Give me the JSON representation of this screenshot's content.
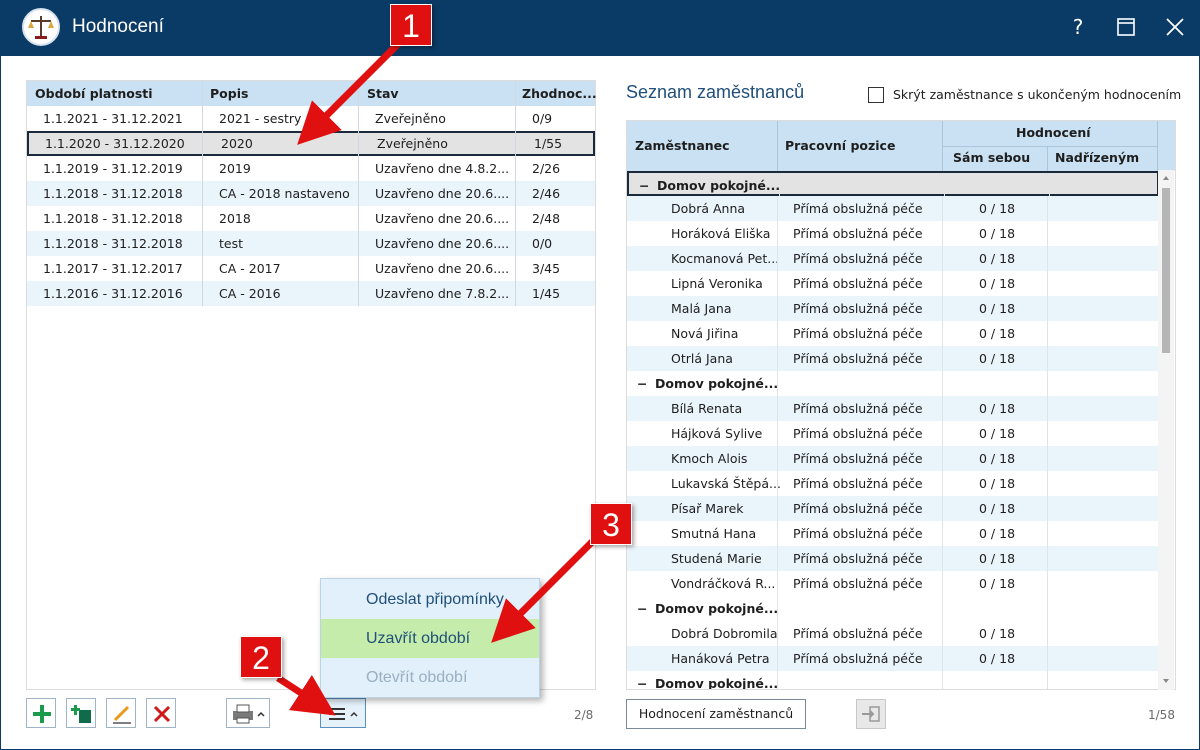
{
  "window": {
    "title": "Hodnocení",
    "help_label": "?",
    "icons": {
      "logo": "scales-icon",
      "help": "help-icon",
      "maximize": "maximize-icon",
      "close": "close-icon"
    }
  },
  "periods": {
    "columns": [
      "Období platnosti",
      "Popis",
      "Stav",
      "Zhodnoc..."
    ],
    "rows": [
      {
        "period": "1.1.2021 - 31.12.2021",
        "desc": "2021 - sestry",
        "state": "Zveřejněno",
        "score": "0/9"
      },
      {
        "period": "1.1.2020 - 31.12.2020",
        "desc": "2020",
        "state": "Zveřejněno",
        "score": "1/55"
      },
      {
        "period": "1.1.2019 - 31.12.2019",
        "desc": "2019",
        "state": "Uzavřeno dne 4.8.2...",
        "score": "2/26"
      },
      {
        "period": "1.1.2018 - 31.12.2018",
        "desc": "CA - 2018 nastaveno",
        "state": "Uzavřeno dne 20.6....",
        "score": "2/46"
      },
      {
        "period": "1.1.2018 - 31.12.2018",
        "desc": "2018",
        "state": "Uzavřeno dne 20.6....",
        "score": "2/48"
      },
      {
        "period": "1.1.2018 - 31.12.2018",
        "desc": "test",
        "state": "Uzavřeno dne 20.6....",
        "score": "0/0"
      },
      {
        "period": "1.1.2017 - 31.12.2017",
        "desc": "CA - 2017",
        "state": "Uzavřeno dne 20.6....",
        "score": "3/45"
      },
      {
        "period": "1.1.2016 - 31.12.2016",
        "desc": "CA - 2016",
        "state": "Uzavřeno dne 7.8.2...",
        "score": "1/45"
      }
    ],
    "pager": "2/8"
  },
  "toolbar": {
    "icons": [
      "add-icon",
      "copy-add-icon",
      "edit-icon",
      "delete-icon",
      "print-icon",
      "menu-icon"
    ]
  },
  "menu": {
    "items": [
      "Odeslat připomínky",
      "Uzavřít období",
      "Otevřít období"
    ]
  },
  "employees": {
    "title": "Seznam zaměstnanců",
    "hide_finished_label": "Skrýt zaměstnance s ukončeným hodnocením",
    "col_employee": "Zaměstnanec",
    "col_position": "Pracovní pozice",
    "col_rating": "Hodnocení",
    "col_self": "Sám sebou",
    "col_superior": "Nadřízeným",
    "group_label": "Domov pokojné...",
    "group_toggle": "−",
    "rows": [
      {
        "type": "group"
      },
      {
        "name": "Dobrá Anna",
        "position": "Přímá obslužná péče",
        "self": "0 / 18"
      },
      {
        "name": "Horáková Eliška",
        "position": "Přímá obslužná péče",
        "self": "0 / 18"
      },
      {
        "name": "Kocmanová Pet...",
        "position": "Přímá obslužná péče",
        "self": "0 / 18"
      },
      {
        "name": "Lipná Veronika",
        "position": "Přímá obslužná péče",
        "self": "0 / 18"
      },
      {
        "name": "Malá Jana",
        "position": "Přímá obslužná péče",
        "self": "0 / 18"
      },
      {
        "name": "Nová Jiřina",
        "position": "Přímá obslužná péče",
        "self": "0 / 18"
      },
      {
        "name": "Otrlá Jana",
        "position": "Přímá obslužná péče",
        "self": "0 / 18"
      },
      {
        "type": "group"
      },
      {
        "name": "Bílá Renata",
        "position": "Přímá obslužná péče",
        "self": "0 / 18"
      },
      {
        "name": "Hájková Sylive",
        "position": "Přímá obslužná péče",
        "self": "0 / 18"
      },
      {
        "name": "Kmoch Alois",
        "position": "Přímá obslužná péče",
        "self": "0 / 18"
      },
      {
        "name": "Lukavská Štěpá...",
        "position": "Přímá obslužná péče",
        "self": "0 / 18"
      },
      {
        "name": "Písař Marek",
        "position": "Přímá obslužná péče",
        "self": "0 / 18"
      },
      {
        "name": "Smutná Hana",
        "position": "Přímá obslužná péče",
        "self": "0 / 18"
      },
      {
        "name": "Studená Marie",
        "position": "Přímá obslužná péče",
        "self": "0 / 18"
      },
      {
        "name": "Vondráčková R...",
        "position": "Přímá obslužná péče",
        "self": "0 / 18"
      },
      {
        "type": "group"
      },
      {
        "name": "Dobrá Dobromila",
        "position": "Přímá obslužná péče",
        "self": "0 / 18"
      },
      {
        "name": "Hanáková Petra",
        "position": "Přímá obslužná péče",
        "self": "0 / 18"
      },
      {
        "type": "group"
      }
    ],
    "button_label": "Hodnocení zaměstnanců",
    "pager": "1/58"
  },
  "annotations": [
    "1",
    "2",
    "3"
  ],
  "colors": {
    "titlebar": "#0a3b67",
    "header": "#c9e1f2",
    "alt_row": "#eaf4fb",
    "accent_red": "#e01010",
    "menu_highlight": "#c6ecab"
  }
}
